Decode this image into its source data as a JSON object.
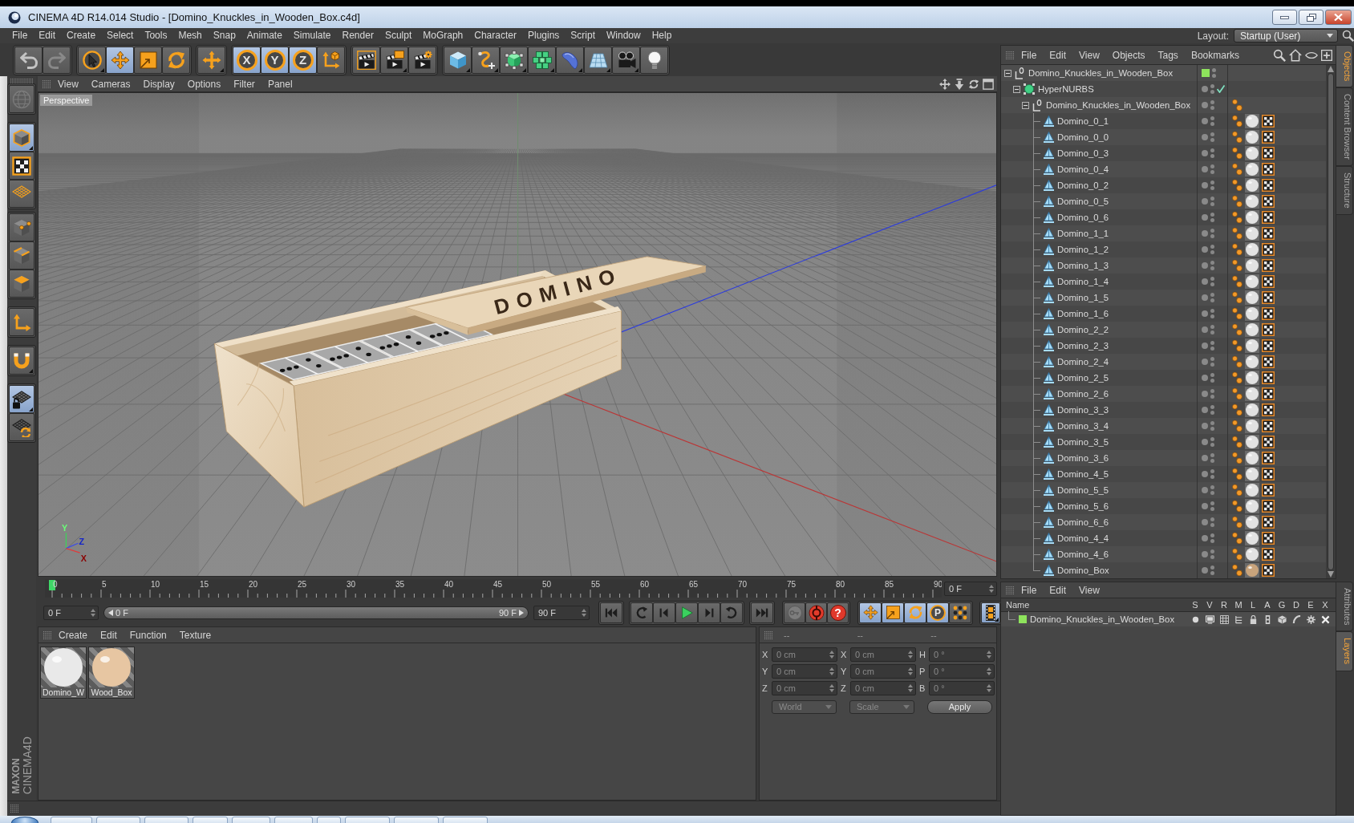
{
  "window": {
    "title": "CINEMA 4D R14.014 Studio - [Domino_Knuckles_in_Wooden_Box.c4d]"
  },
  "menu": [
    "File",
    "Edit",
    "Create",
    "Select",
    "Tools",
    "Mesh",
    "Snap",
    "Animate",
    "Simulate",
    "Render",
    "Sculpt",
    "MoGraph",
    "Character",
    "Plugins",
    "Script",
    "Window",
    "Help"
  ],
  "layout": {
    "label": "Layout:",
    "value": "Startup (User)"
  },
  "toolbar": {
    "groups": [
      [
        {
          "selected": false,
          "disabled": false
        },
        {
          "selected": false,
          "disabled": true
        }
      ],
      [
        {
          "selected": false,
          "disabled": false
        },
        {
          "selected": true,
          "disabled": false
        },
        {
          "selected": false,
          "disabled": false
        },
        {
          "selected": false,
          "disabled": false
        }
      ],
      [
        {
          "selected": false,
          "disabled": false
        }
      ],
      [
        {
          "label": "X",
          "selected": true,
          "disabled": false
        },
        {
          "label": "Y",
          "selected": true,
          "disabled": false
        },
        {
          "label": "Z",
          "selected": true,
          "disabled": false
        },
        {
          "selected": false,
          "disabled": false
        }
      ],
      [
        {
          "selected": false,
          "disabled": false
        },
        {
          "selected": false,
          "disabled": false
        },
        {
          "selected": false,
          "disabled": false
        }
      ],
      [
        {
          "selected": false,
          "disabled": false
        },
        {
          "selected": false,
          "disabled": false
        },
        {
          "selected": false,
          "disabled": false
        },
        {
          "selected": false,
          "disabled": false
        },
        {
          "selected": false,
          "disabled": false
        },
        {
          "selected": false,
          "disabled": false
        },
        {
          "selected": false,
          "disabled": false
        },
        {
          "selected": false,
          "disabled": false
        }
      ]
    ]
  },
  "tool_palette": {
    "groups": [
      [
        {
          "selected": false,
          "disabled": true
        }
      ],
      [
        {
          "selected": true,
          "disabled": false
        },
        {
          "selected": false,
          "disabled": false
        },
        {
          "selected": false,
          "disabled": false
        }
      ],
      [
        {
          "selected": false,
          "disabled": false
        },
        {
          "selected": false,
          "disabled": false
        },
        {
          "selected": false,
          "disabled": false
        }
      ],
      [
        {
          "selected": false,
          "disabled": false
        }
      ],
      [
        {
          "selected": false,
          "disabled": false
        }
      ],
      [
        {
          "selected": true,
          "disabled": false
        },
        {
          "selected": false,
          "disabled": false
        }
      ]
    ]
  },
  "logo": {
    "brand": "MAXON",
    "product": "CINEMA4D"
  },
  "viewport": {
    "menu": [
      "View",
      "Cameras",
      "Display",
      "Options",
      "Filter",
      "Panel"
    ],
    "camera": "Perspective",
    "box_label": "DOMINO",
    "gizmo_labels": [
      "Y",
      "Z",
      "X"
    ]
  },
  "timeline": {
    "ticks": [
      "0",
      "5",
      "10",
      "15",
      "20",
      "25",
      "30",
      "35",
      "40",
      "45",
      "50",
      "55",
      "60",
      "65",
      "70",
      "75",
      "80",
      "85",
      "90"
    ],
    "playhead": {
      "level": 0
    },
    "current_frame": "0 F",
    "start": "0 F",
    "range": {
      "start": "0 F",
      "end": "90 F",
      "level": 1
    },
    "end": "90 F"
  },
  "transport": {
    "record": [
      {
        "disabled": true
      },
      {
        "disabled": false
      },
      {
        "label": "?",
        "disabled": false
      }
    ],
    "keys": [
      {
        "selected": true
      },
      {
        "selected": true
      },
      {
        "selected": true
      },
      {
        "label": "P",
        "selected": true
      },
      {
        "selected": false
      }
    ],
    "film": {
      "selected": true
    }
  },
  "materials": {
    "menu": [
      "Create",
      "Edit",
      "Function",
      "Texture"
    ],
    "items": [
      {
        "name": "Domino_W",
        "color": "#e9e9e9"
      },
      {
        "name": "Wood_Box",
        "color": "#e7c6a2"
      }
    ]
  },
  "coordinates": {
    "disabled": true,
    "headers": [
      "--",
      "--",
      "--"
    ],
    "rows": [
      [
        {
          "axis": "X",
          "value": "0 cm"
        },
        {
          "axis": "X",
          "value": "0 cm"
        },
        {
          "axis": "H",
          "value": "0 °"
        }
      ],
      [
        {
          "axis": "Y",
          "value": "0 cm"
        },
        {
          "axis": "Y",
          "value": "0 cm"
        },
        {
          "axis": "P",
          "value": "0 °"
        }
      ],
      [
        {
          "axis": "Z",
          "value": "0 cm"
        },
        {
          "axis": "Z",
          "value": "0 cm"
        },
        {
          "axis": "B",
          "value": "0 °"
        }
      ]
    ],
    "mode": "World",
    "transform": "Scale",
    "apply": "Apply"
  },
  "objects": {
    "menu": [
      "File",
      "Edit",
      "View",
      "Objects",
      "Tags",
      "Bookmarks"
    ],
    "tree": [
      {
        "name": "Domino_Knuckles_in_Wooden_Box",
        "kind": "null",
        "expanded": true,
        "color": "#8ee35c",
        "children": [
          {
            "name": "HyperNURBS",
            "kind": "subdivision",
            "expanded": true,
            "enabled": true,
            "children": [
              {
                "name": "Domino_Knuckles_in_Wooden_Box",
                "kind": "null",
                "expanded": true,
                "tags": [
                  {
                    "kind": "phong"
                  }
                ],
                "children": [
                  {
                    "name": "Domino_0_1",
                    "kind": "polygon",
                    "tags": [
                      {
                        "kind": "phong"
                      },
                      {
                        "kind": "material",
                        "color": "#e2e2e2"
                      },
                      {
                        "kind": "uvw"
                      }
                    ]
                  },
                  {
                    "name": "Domino_0_0",
                    "kind": "polygon",
                    "tags": [
                      {
                        "kind": "phong"
                      },
                      {
                        "kind": "material",
                        "color": "#e2e2e2"
                      },
                      {
                        "kind": "uvw"
                      }
                    ]
                  },
                  {
                    "name": "Domino_0_3",
                    "kind": "polygon",
                    "tags": [
                      {
                        "kind": "phong"
                      },
                      {
                        "kind": "material",
                        "color": "#e2e2e2"
                      },
                      {
                        "kind": "uvw"
                      }
                    ]
                  },
                  {
                    "name": "Domino_0_4",
                    "kind": "polygon",
                    "tags": [
                      {
                        "kind": "phong"
                      },
                      {
                        "kind": "material",
                        "color": "#e2e2e2"
                      },
                      {
                        "kind": "uvw"
                      }
                    ]
                  },
                  {
                    "name": "Domino_0_2",
                    "kind": "polygon",
                    "tags": [
                      {
                        "kind": "phong"
                      },
                      {
                        "kind": "material",
                        "color": "#e2e2e2"
                      },
                      {
                        "kind": "uvw"
                      }
                    ]
                  },
                  {
                    "name": "Domino_0_5",
                    "kind": "polygon",
                    "tags": [
                      {
                        "kind": "phong"
                      },
                      {
                        "kind": "material",
                        "color": "#e2e2e2"
                      },
                      {
                        "kind": "uvw"
                      }
                    ]
                  },
                  {
                    "name": "Domino_0_6",
                    "kind": "polygon",
                    "tags": [
                      {
                        "kind": "phong"
                      },
                      {
                        "kind": "material",
                        "color": "#e2e2e2"
                      },
                      {
                        "kind": "uvw"
                      }
                    ]
                  },
                  {
                    "name": "Domino_1_1",
                    "kind": "polygon",
                    "tags": [
                      {
                        "kind": "phong"
                      },
                      {
                        "kind": "material",
                        "color": "#e2e2e2"
                      },
                      {
                        "kind": "uvw"
                      }
                    ]
                  },
                  {
                    "name": "Domino_1_2",
                    "kind": "polygon",
                    "tags": [
                      {
                        "kind": "phong"
                      },
                      {
                        "kind": "material",
                        "color": "#e2e2e2"
                      },
                      {
                        "kind": "uvw"
                      }
                    ]
                  },
                  {
                    "name": "Domino_1_3",
                    "kind": "polygon",
                    "tags": [
                      {
                        "kind": "phong"
                      },
                      {
                        "kind": "material",
                        "color": "#e2e2e2"
                      },
                      {
                        "kind": "uvw"
                      }
                    ]
                  },
                  {
                    "name": "Domino_1_4",
                    "kind": "polygon",
                    "tags": [
                      {
                        "kind": "phong"
                      },
                      {
                        "kind": "material",
                        "color": "#e2e2e2"
                      },
                      {
                        "kind": "uvw"
                      }
                    ]
                  },
                  {
                    "name": "Domino_1_5",
                    "kind": "polygon",
                    "tags": [
                      {
                        "kind": "phong"
                      },
                      {
                        "kind": "material",
                        "color": "#e2e2e2"
                      },
                      {
                        "kind": "uvw"
                      }
                    ]
                  },
                  {
                    "name": "Domino_1_6",
                    "kind": "polygon",
                    "tags": [
                      {
                        "kind": "phong"
                      },
                      {
                        "kind": "material",
                        "color": "#e2e2e2"
                      },
                      {
                        "kind": "uvw"
                      }
                    ]
                  },
                  {
                    "name": "Domino_2_2",
                    "kind": "polygon",
                    "tags": [
                      {
                        "kind": "phong"
                      },
                      {
                        "kind": "material",
                        "color": "#e2e2e2"
                      },
                      {
                        "kind": "uvw"
                      }
                    ]
                  },
                  {
                    "name": "Domino_2_3",
                    "kind": "polygon",
                    "tags": [
                      {
                        "kind": "phong"
                      },
                      {
                        "kind": "material",
                        "color": "#e2e2e2"
                      },
                      {
                        "kind": "uvw"
                      }
                    ]
                  },
                  {
                    "name": "Domino_2_4",
                    "kind": "polygon",
                    "tags": [
                      {
                        "kind": "phong"
                      },
                      {
                        "kind": "material",
                        "color": "#e2e2e2"
                      },
                      {
                        "kind": "uvw"
                      }
                    ]
                  },
                  {
                    "name": "Domino_2_5",
                    "kind": "polygon",
                    "tags": [
                      {
                        "kind": "phong"
                      },
                      {
                        "kind": "material",
                        "color": "#e2e2e2"
                      },
                      {
                        "kind": "uvw"
                      }
                    ]
                  },
                  {
                    "name": "Domino_2_6",
                    "kind": "polygon",
                    "tags": [
                      {
                        "kind": "phong"
                      },
                      {
                        "kind": "material",
                        "color": "#e2e2e2"
                      },
                      {
                        "kind": "uvw"
                      }
                    ]
                  },
                  {
                    "name": "Domino_3_3",
                    "kind": "polygon",
                    "tags": [
                      {
                        "kind": "phong"
                      },
                      {
                        "kind": "material",
                        "color": "#e2e2e2"
                      },
                      {
                        "kind": "uvw"
                      }
                    ]
                  },
                  {
                    "name": "Domino_3_4",
                    "kind": "polygon",
                    "tags": [
                      {
                        "kind": "phong"
                      },
                      {
                        "kind": "material",
                        "color": "#e2e2e2"
                      },
                      {
                        "kind": "uvw"
                      }
                    ]
                  },
                  {
                    "name": "Domino_3_5",
                    "kind": "polygon",
                    "tags": [
                      {
                        "kind": "phong"
                      },
                      {
                        "kind": "material",
                        "color": "#e2e2e2"
                      },
                      {
                        "kind": "uvw"
                      }
                    ]
                  },
                  {
                    "name": "Domino_3_6",
                    "kind": "polygon",
                    "tags": [
                      {
                        "kind": "phong"
                      },
                      {
                        "kind": "material",
                        "color": "#e2e2e2"
                      },
                      {
                        "kind": "uvw"
                      }
                    ]
                  },
                  {
                    "name": "Domino_4_5",
                    "kind": "polygon",
                    "tags": [
                      {
                        "kind": "phong"
                      },
                      {
                        "kind": "material",
                        "color": "#e2e2e2"
                      },
                      {
                        "kind": "uvw"
                      }
                    ]
                  },
                  {
                    "name": "Domino_5_5",
                    "kind": "polygon",
                    "tags": [
                      {
                        "kind": "phong"
                      },
                      {
                        "kind": "material",
                        "color": "#e2e2e2"
                      },
                      {
                        "kind": "uvw"
                      }
                    ]
                  },
                  {
                    "name": "Domino_5_6",
                    "kind": "polygon",
                    "tags": [
                      {
                        "kind": "phong"
                      },
                      {
                        "kind": "material",
                        "color": "#e2e2e2"
                      },
                      {
                        "kind": "uvw"
                      }
                    ]
                  },
                  {
                    "name": "Domino_6_6",
                    "kind": "polygon",
                    "tags": [
                      {
                        "kind": "phong"
                      },
                      {
                        "kind": "material",
                        "color": "#e2e2e2"
                      },
                      {
                        "kind": "uvw"
                      }
                    ]
                  },
                  {
                    "name": "Domino_4_4",
                    "kind": "polygon",
                    "tags": [
                      {
                        "kind": "phong"
                      },
                      {
                        "kind": "material",
                        "color": "#e2e2e2"
                      },
                      {
                        "kind": "uvw"
                      }
                    ]
                  },
                  {
                    "name": "Domino_4_6",
                    "kind": "polygon",
                    "tags": [
                      {
                        "kind": "phong"
                      },
                      {
                        "kind": "material",
                        "color": "#e2e2e2"
                      },
                      {
                        "kind": "uvw"
                      }
                    ]
                  },
                  {
                    "name": "Domino_Box",
                    "kind": "polygon",
                    "tags": [
                      {
                        "kind": "phong"
                      },
                      {
                        "kind": "material",
                        "color": "#c9a47c"
                      },
                      {
                        "kind": "uvw"
                      }
                    ]
                  }
                ]
              }
            ]
          }
        ]
      }
    ]
  },
  "layers": {
    "menu": [
      "File",
      "Edit",
      "View"
    ],
    "columns": [
      "Name",
      "S",
      "V",
      "R",
      "M",
      "L",
      "A",
      "G",
      "D",
      "E",
      "X"
    ],
    "rows": [
      {
        "name": "Domino_Knuckles_in_Wooden_Box",
        "color": "#8ee35c"
      }
    ]
  },
  "side_tabs": {
    "top": [
      {
        "label": "Objects",
        "selected": true
      },
      {
        "label": "Content Browser",
        "selected": false
      },
      {
        "label": "Structure",
        "selected": false
      }
    ],
    "bottom": [
      {
        "label": "Attributes",
        "selected": false
      },
      {
        "label": "Layers",
        "selected": true
      }
    ]
  }
}
